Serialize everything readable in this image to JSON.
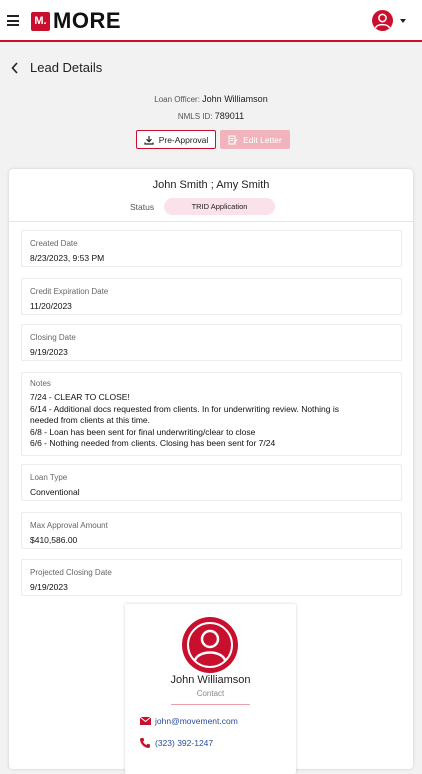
{
  "app": {
    "logo_mark": "M.",
    "logo_text": "MORE"
  },
  "colors": {
    "brand": "#c8102e",
    "status_pill_bg": "#fbe1ea",
    "edit_button_bg": "#f1b4bd",
    "link": "#2a4b9b"
  },
  "icons": [
    "menu-icon",
    "user-avatar-icon",
    "chevron-down-icon",
    "chevron-left-icon",
    "download-icon",
    "edit-letter-icon",
    "mail-icon",
    "phone-icon"
  ],
  "header": {
    "title": "Lead Details"
  },
  "officer": {
    "label": "Loan Officer:",
    "name": "John Williamson",
    "nmls_label": "NMLS ID:",
    "nmls_id": "789011"
  },
  "actions": {
    "preapproval_label": "Pre-Approval",
    "edit_letter_label": "Edit Letter"
  },
  "lead": {
    "names": "John Smith ; Amy Smith",
    "status_label": "Status",
    "status_value": "TRID Application"
  },
  "fields": [
    {
      "label": "Created Date",
      "value": "8/23/2023, 9:53 PM"
    },
    {
      "label": "Credit Expiration Date",
      "value": "11/20/2023"
    },
    {
      "label": "Closing Date",
      "value": "9/19/2023"
    },
    {
      "label": "Loan Type",
      "value": "Conventional"
    },
    {
      "label": "Max Approval Amount",
      "value": "$410,586.00"
    },
    {
      "label": "Projected Closing Date",
      "value": "9/19/2023"
    }
  ],
  "notes": {
    "label": "Notes",
    "lines": [
      "7/24 - CLEAR TO CLOSE!",
      "6/14 - Additional docs requested from clients. In for underwriting review. Nothing is",
      "needed from clients at this time.",
      "6/8 - Loan has been sent for final underwriting/clear to close",
      "6/6 - Nothing needed from clients. Closing has been sent for 7/24"
    ]
  },
  "contact": {
    "name": "John Williamson",
    "role": "Contact",
    "email": "john@movement.com",
    "phone": "(323) 392-1247"
  }
}
